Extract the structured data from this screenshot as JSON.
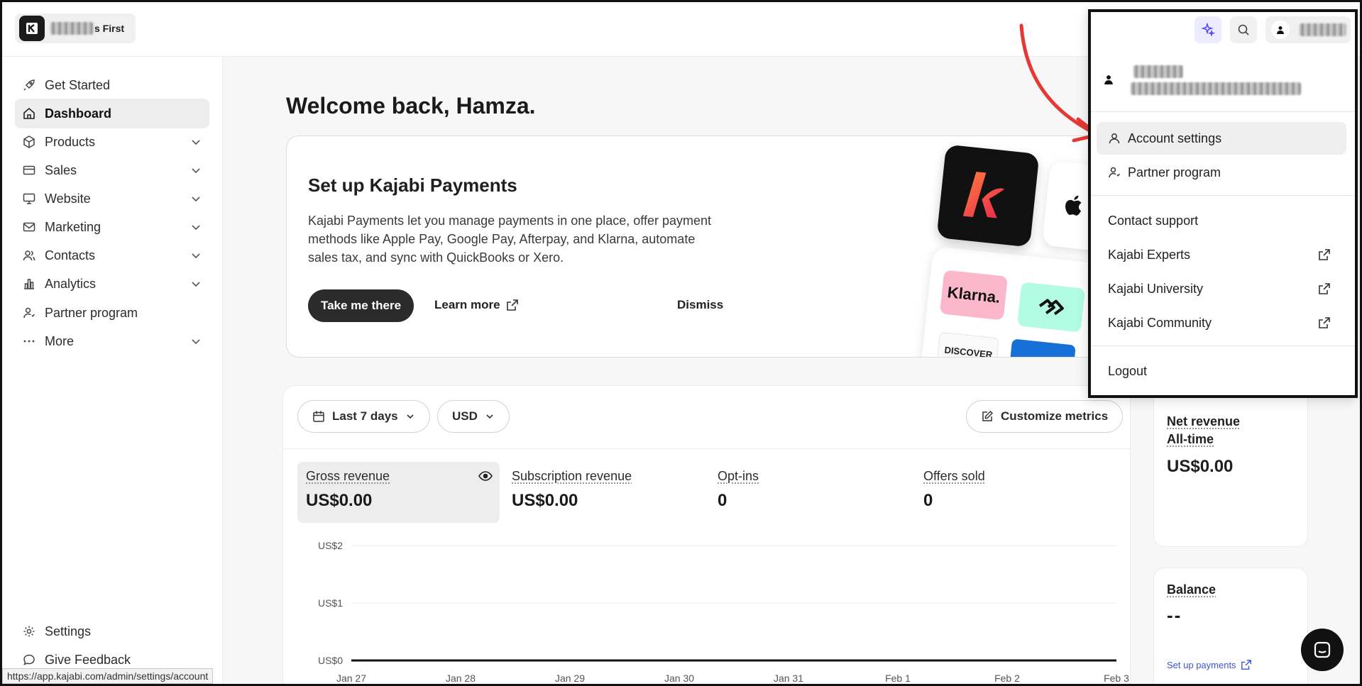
{
  "site": {
    "name_suffix": "s First"
  },
  "sidebar": {
    "items": [
      {
        "label": "Get Started"
      },
      {
        "label": "Dashboard"
      },
      {
        "label": "Products"
      },
      {
        "label": "Sales"
      },
      {
        "label": "Website"
      },
      {
        "label": "Marketing"
      },
      {
        "label": "Contacts"
      },
      {
        "label": "Analytics"
      },
      {
        "label": "Partner program"
      },
      {
        "label": "More"
      }
    ],
    "bottom": [
      {
        "label": "Settings"
      },
      {
        "label": "Give Feedback"
      }
    ]
  },
  "status_url": "https://app.kajabi.com/admin/settings/account",
  "main": {
    "welcome": "Welcome back, Hamza.",
    "payments": {
      "title": "Set up Kajabi Payments",
      "description": "Kajabi Payments let you manage payments in one place, offer payment methods like Apple Pay, Google Pay, Afterpay, and Klarna, automate sales tax, and sync with QuickBooks or Xero.",
      "primary": "Take me there",
      "learn_more": "Learn more",
      "dismiss": "Dismiss",
      "klarna": "Klarna.",
      "discover": "DISCOVER"
    },
    "filters": {
      "range": "Last 7 days",
      "currency": "USD",
      "customize": "Customize metrics"
    },
    "metrics": [
      {
        "label": "Gross revenue",
        "value": "US$0.00"
      },
      {
        "label": "Subscription revenue",
        "value": "US$0.00"
      },
      {
        "label": "Opt-ins",
        "value": "0"
      },
      {
        "label": "Offers sold",
        "value": "0"
      }
    ]
  },
  "chart_data": {
    "type": "line",
    "x": [
      "Jan 27",
      "Jan 28",
      "Jan 29",
      "Jan 30",
      "Jan 31",
      "Feb 1",
      "Feb 2",
      "Feb 3"
    ],
    "series": [
      {
        "values": [
          0,
          0,
          0,
          0,
          0,
          0,
          0,
          0
        ]
      }
    ],
    "y_ticks": [
      "US$2",
      "US$1",
      "US$0"
    ],
    "ylim": [
      0,
      2
    ],
    "grid": true
  },
  "right_cards": {
    "net_revenue": {
      "label": "Net revenue",
      "sublabel": "All-time",
      "value": "US$0.00"
    },
    "balance": {
      "label": "Balance",
      "value": "--",
      "link": "Set up payments"
    }
  },
  "account_menu": {
    "items": [
      {
        "label": "Account settings"
      },
      {
        "label": "Partner program"
      },
      {
        "label": "Contact support"
      },
      {
        "label": "Kajabi Experts"
      },
      {
        "label": "Kajabi University"
      },
      {
        "label": "Kajabi Community"
      },
      {
        "label": "Logout"
      }
    ]
  },
  "colors": {
    "accent_arrow": "#e53935",
    "primary_dark": "#2b2b2b",
    "sparkle": "#5b4cf0"
  },
  "icons": [
    "rocket-icon",
    "home-icon",
    "box-icon",
    "card-icon",
    "monitor-icon",
    "mail-icon",
    "users-icon",
    "chart-icon",
    "partner-icon",
    "dots-icon",
    "gear-icon",
    "chat-bubble-icon",
    "sparkle-icon",
    "search-icon",
    "user-icon",
    "external-link-icon",
    "calendar-icon",
    "pencil-icon",
    "eye-icon"
  ]
}
